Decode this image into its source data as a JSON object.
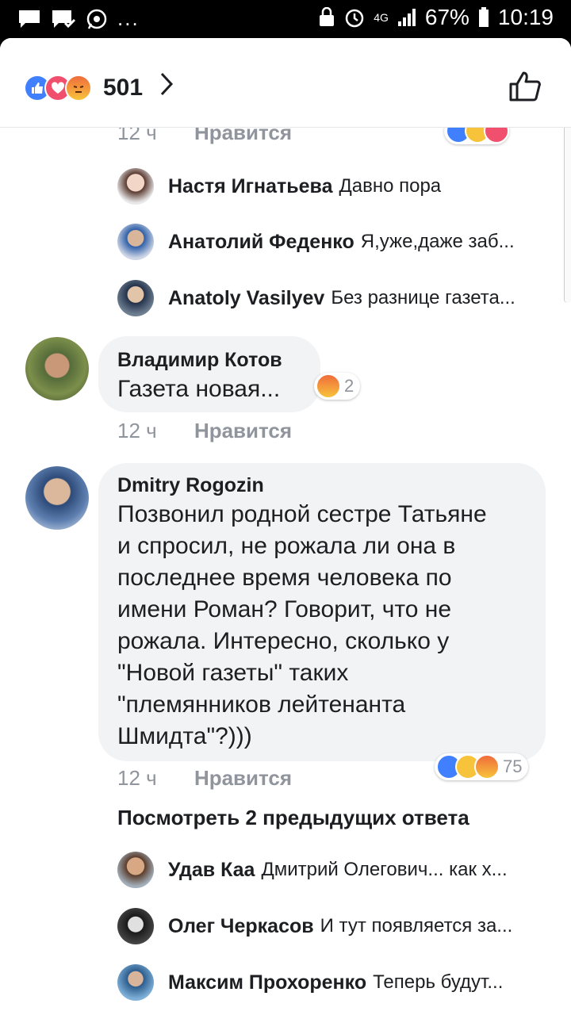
{
  "status_bar": {
    "battery": "67%",
    "time": "10:19",
    "network": "4G",
    "more": "..."
  },
  "header": {
    "reaction_icons": [
      "like-icon",
      "love-icon",
      "angry-icon"
    ],
    "total": "501"
  },
  "partial_comment": {
    "time": "12 ч",
    "like_label": "Нравится"
  },
  "replies_a": [
    {
      "name": "Настя Игнатьева",
      "text": "Давно пора"
    },
    {
      "name": "Анатолий Феденко",
      "text": "Я,уже,даже заб..."
    },
    {
      "name": "Anatoly Vasilyev",
      "text": "Без разнице газета..."
    }
  ],
  "comment_1": {
    "name": "Владимир Котов",
    "text": "Газета новая...",
    "time": "12 ч",
    "like_label": "Нравится",
    "reaction_count": "2"
  },
  "comment_2": {
    "name": "Dmitry Rogozin",
    "lines": [
      "Позвонил родной сестре Татьяне",
      "и спросил, не рожала ли она в",
      "последнее время человека по",
      "имени Роман? Говорит, что не",
      "рожала. Интересно, сколько у",
      "\"Новой газеты\" таких",
      "\"племянников лейтенанта",
      "Шмидта\"?)))"
    ],
    "time": "12 ч",
    "like_label": "Нравится",
    "reaction_count": "75"
  },
  "view_previous": "Посмотреть 2 предыдущих ответа",
  "replies_b": [
    {
      "name": "Удав Каа",
      "text": "Дмитрий Олегович... как х..."
    },
    {
      "name": "Олег Черкасов",
      "text": "И тут появляется за..."
    },
    {
      "name": "Максим Прохоренко",
      "text": "Теперь будут..."
    }
  ],
  "colors": {
    "like": "#4080ff",
    "love": "#f0506e",
    "angry": "#f06c3b",
    "haha": "#f7c33b",
    "meta": "#90949c",
    "bubble": "#f2f3f5"
  }
}
